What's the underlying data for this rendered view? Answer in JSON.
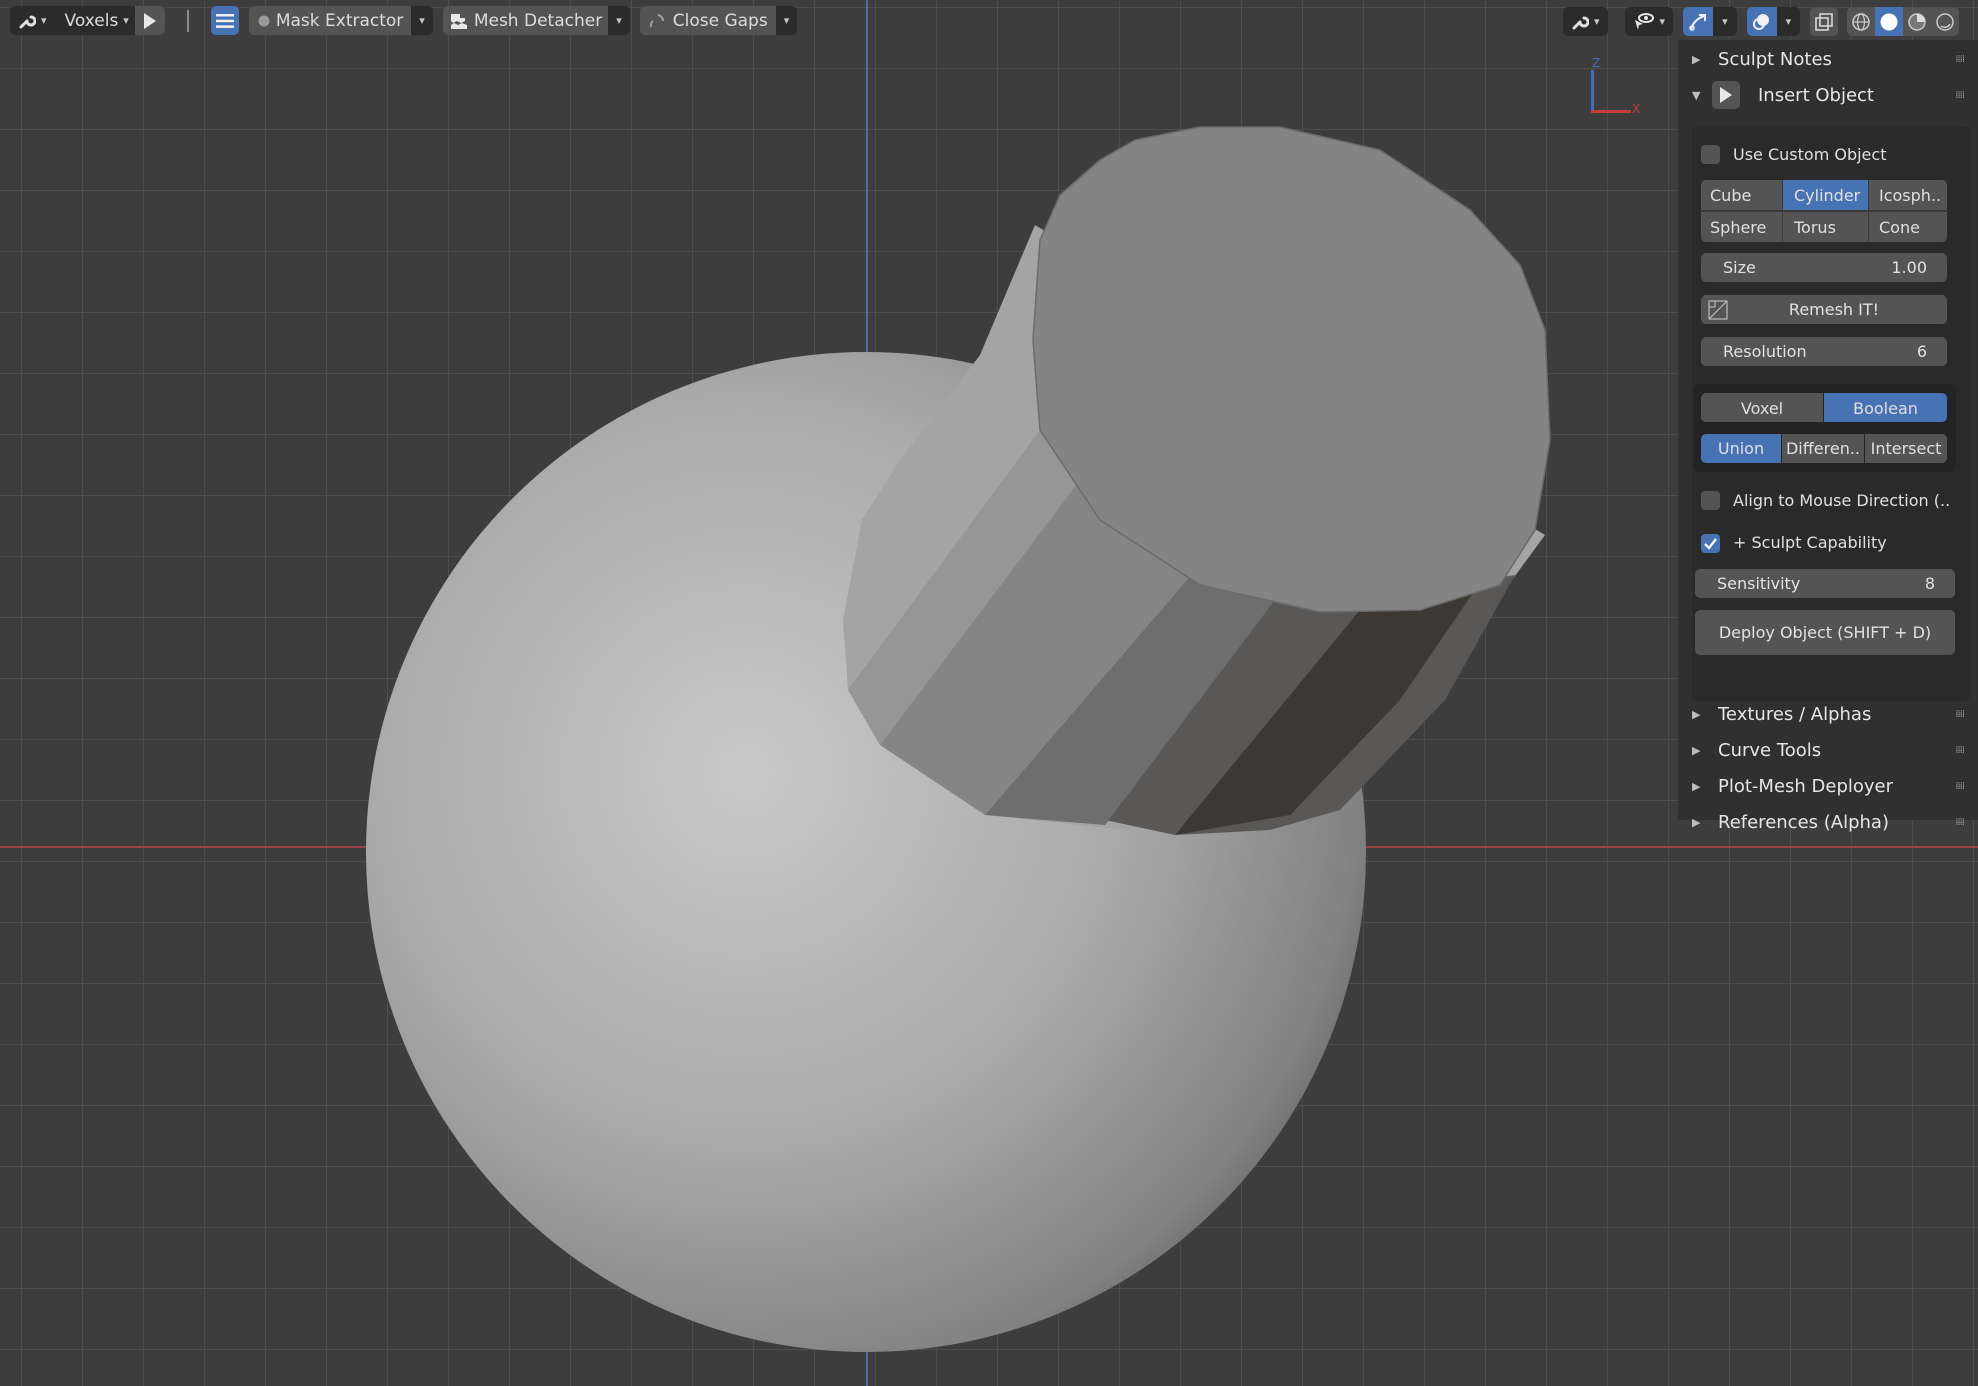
{
  "toolbar": {
    "tool_settings_icon": "wrench-icon",
    "remesh_mode": "Voxels",
    "run_icon": "play-icon",
    "menu_icon": "hamburger-icon",
    "mask_extractor_label": "Mask Extractor",
    "mesh_detacher_label": "Mesh Detacher",
    "close_gaps_label": "Close Gaps"
  },
  "header_right": {
    "icons": [
      "wrench-icon",
      "visibility-icon",
      "gizmo-icon",
      "overlay-icon",
      "xray-icon",
      "wireframe-shading-icon",
      "solid-shading-icon",
      "material-shading-icon",
      "rendered-shading-icon"
    ],
    "active_shading": "solid",
    "colors": {
      "active": "#4772b3"
    }
  },
  "gizmo": {
    "x_label": "X",
    "z_label": "Z",
    "x_color": "#c43c3c",
    "z_color": "#3f6fc0"
  },
  "panel": {
    "sections_top": [
      {
        "label": "Sculpt Notes",
        "expanded": false
      }
    ],
    "insert_object": {
      "label": "Insert Object",
      "expanded": true,
      "use_custom_object": {
        "label": "Use Custom Object",
        "checked": false
      },
      "primitives": [
        "Cube",
        "Cylinder",
        "Icosph..",
        "Sphere",
        "Torus",
        "Cone"
      ],
      "selected_primitive": "Cylinder",
      "size": {
        "label": "Size",
        "value": "1.00"
      },
      "remesh_button": "Remesh IT!",
      "resolution": {
        "label": "Resolution",
        "value": "6"
      },
      "mode_options": [
        "Voxel",
        "Boolean"
      ],
      "selected_mode": "Boolean",
      "boolean_ops": [
        "Union",
        "Differen..",
        "Intersect"
      ],
      "selected_op": "Union",
      "align_mouse": {
        "label": "Align to Mouse Direction (..",
        "checked": false
      },
      "sculpt_capability": {
        "label": "+ Sculpt Capability",
        "checked": true
      },
      "sensitivity": {
        "label": "Sensitivity",
        "value": "8"
      },
      "deploy_button": "Deploy Object (SHIFT + D)"
    },
    "sections_bottom": [
      {
        "label": "Textures / Alphas",
        "expanded": false
      },
      {
        "label": "Curve Tools",
        "expanded": false
      },
      {
        "label": "Plot-Mesh Deployer",
        "expanded": false
      },
      {
        "label": "References (Alpha)",
        "expanded": false
      }
    ]
  }
}
